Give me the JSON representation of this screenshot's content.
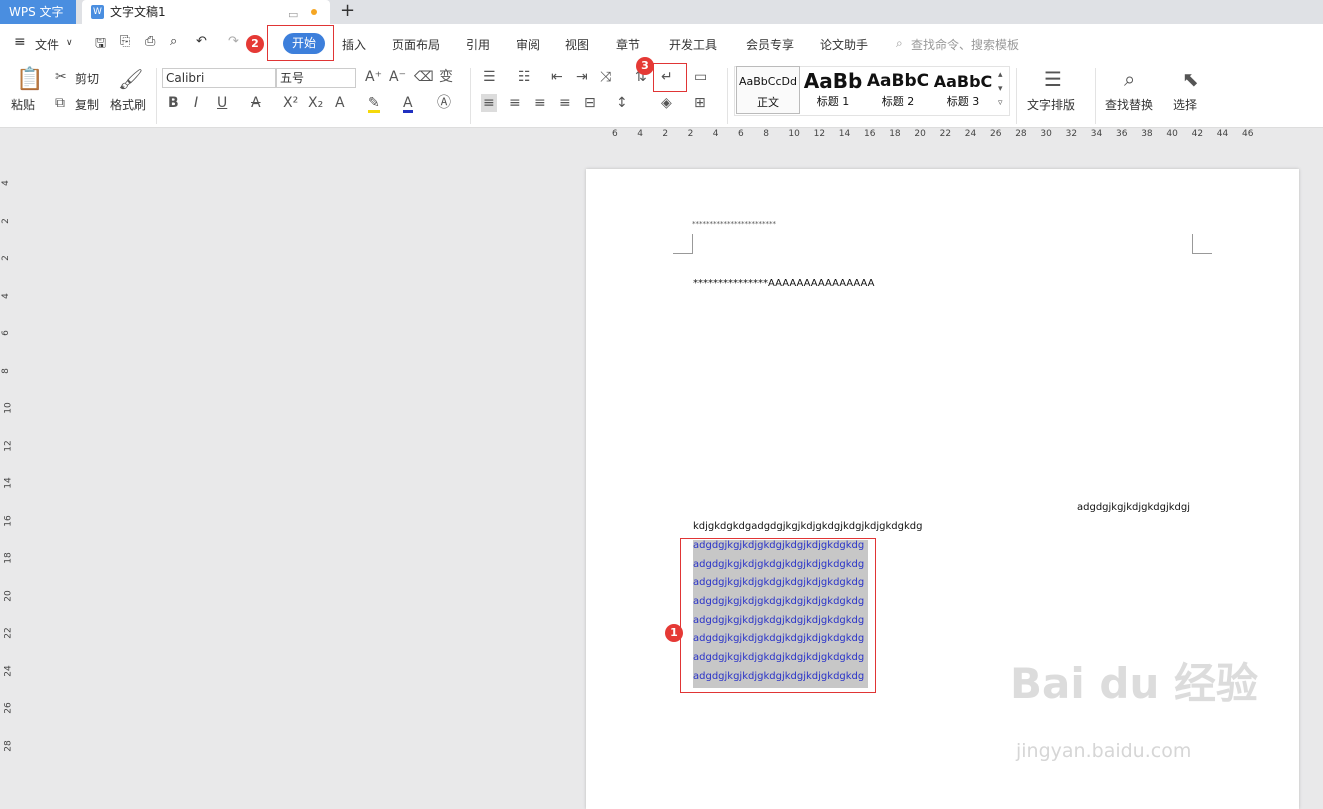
{
  "titlebar": {
    "app_tab": "WPS 文字",
    "doc_tab": "文字文稿1",
    "new_tab": "+"
  },
  "menu": {
    "file": "文件",
    "tabs": [
      "开始",
      "插入",
      "页面布局",
      "引用",
      "审阅",
      "视图",
      "章节",
      "开发工具",
      "会员专享",
      "论文助手"
    ],
    "search_placeholder": "查找命令、搜索模板"
  },
  "ribbon": {
    "paste": "粘贴",
    "cut": "剪切",
    "copy": "复制",
    "format_painter": "格式刷",
    "font_name": "Calibri",
    "font_size": "五号",
    "styles": [
      {
        "preview": "AaBbCcDd",
        "label": "正文"
      },
      {
        "preview": "AaBb",
        "label": "标题 1"
      },
      {
        "preview": "AaBbC",
        "label": "标题 2"
      },
      {
        "preview": "AaBbC",
        "label": "标题 3"
      }
    ],
    "text_layout": "文字排版",
    "find_replace": "查找替换",
    "select": "选择"
  },
  "ruler": {
    "h_ticks": [
      "6",
      "4",
      "2",
      "2",
      "4",
      "6",
      "8",
      "10",
      "12",
      "14",
      "16",
      "18",
      "20",
      "22",
      "24",
      "26",
      "28",
      "30",
      "32",
      "34",
      "36",
      "38",
      "40",
      "42",
      "44",
      "46"
    ],
    "v_ticks": [
      "4",
      "2",
      "2",
      "4",
      "6",
      "8",
      "10",
      "12",
      "14",
      "16",
      "18",
      "20",
      "22",
      "24",
      "26",
      "28"
    ]
  },
  "document": {
    "header_line": "************************",
    "line1": "***************AAAAAAAAAAAAAAA",
    "right_line": "adgdgjkgjkdjgkdgjkdgj",
    "line2": "kdjgkdgkdgadgdgjkgjkdjgkdgjkdgjkdjgkdgkdg",
    "selected_lines": [
      "adgdgjkgjkdjgkdgjkdgjkdjgkdgkdg",
      "adgdgjkgjkdjgkdgjkdgjkdjgkdgkdg",
      "adgdgjkgjkdjgkdgjkdgjkdjgkdgkdg",
      "adgdgjkgjkdjgkdgjkdgjkdjgkdgkdg",
      "adgdgjkgjkdjgkdgjkdgjkdjgkdgkdg",
      "adgdgjkgjkdjgkdgjkdgjkdjgkdgkdg",
      "adgdgjkgjkdjgkdgjkdgjkdjgkdgkdg",
      "adgdgjkgjkdjgkdgjkdgjkdjgkdgkdg"
    ]
  },
  "annotations": {
    "badge1": "1",
    "badge2": "2",
    "badge3": "3"
  },
  "watermark": {
    "main": "Bai du 经验",
    "sub": "jingyan.baidu.com"
  },
  "colors": {
    "accent": "#3d7fdb",
    "annotation": "#e03535",
    "selection_text": "#2a33c8"
  }
}
